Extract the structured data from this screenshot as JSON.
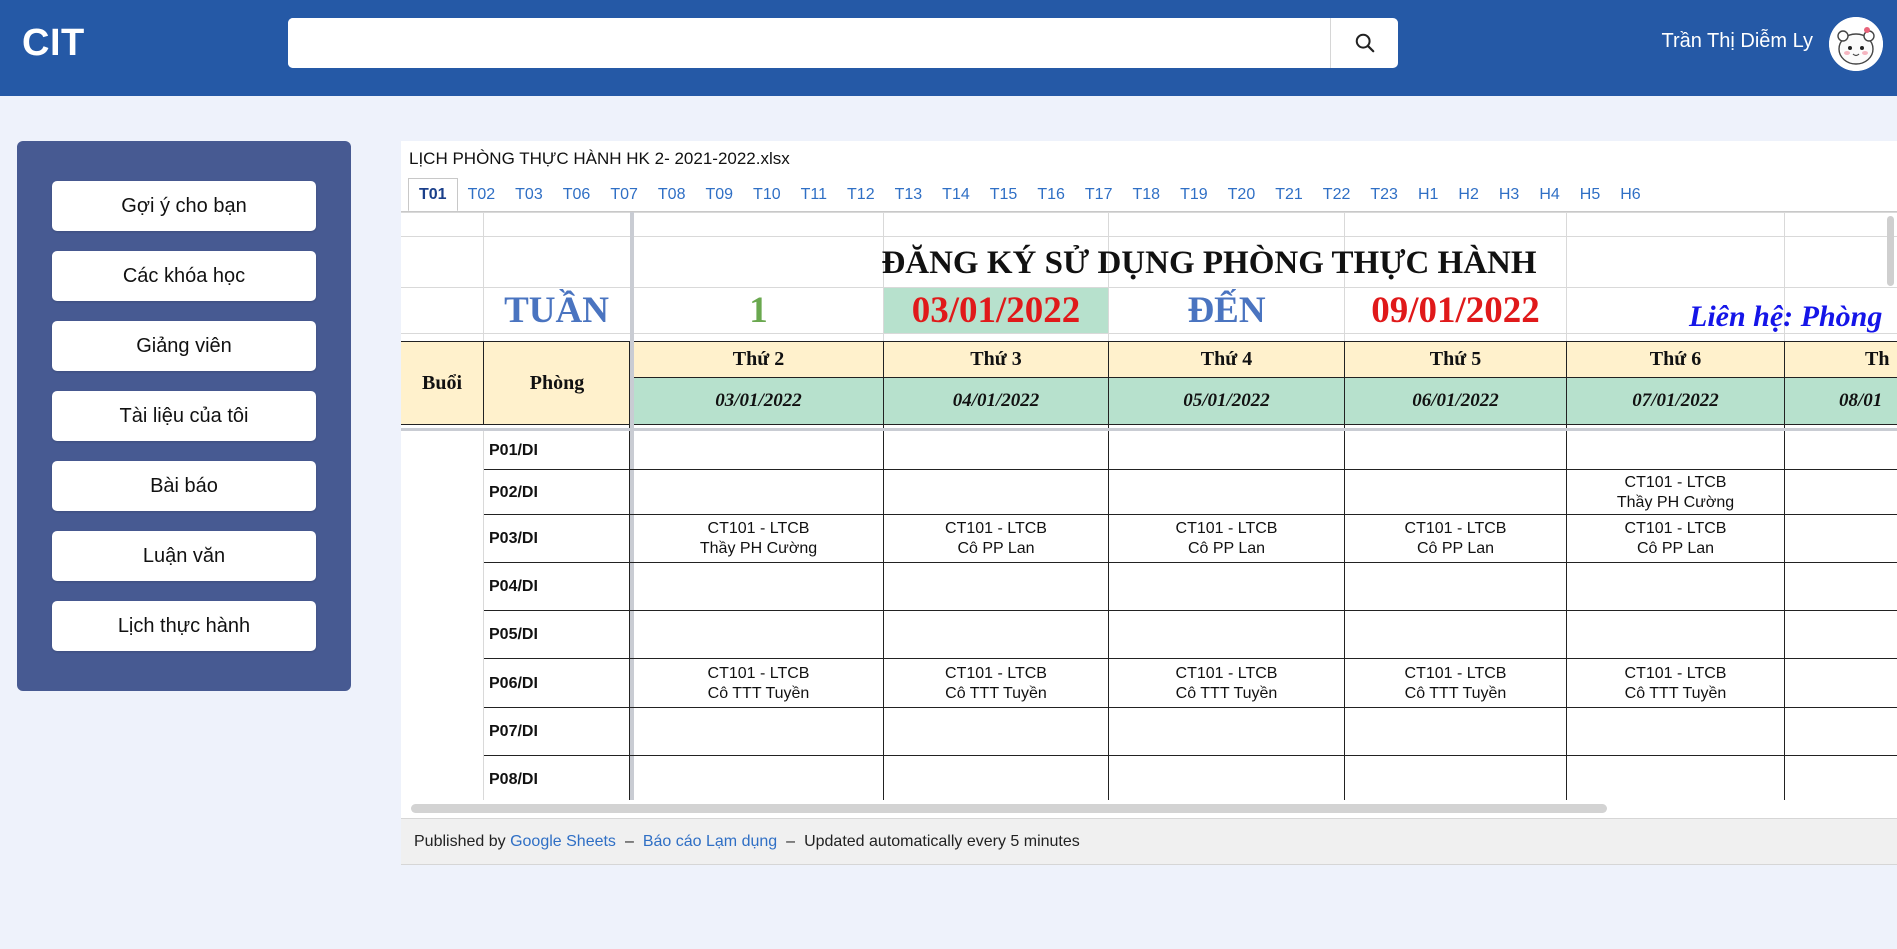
{
  "header": {
    "brand": "CIT",
    "search_placeholder": "",
    "user_name": "Trần Thị Diễm Ly"
  },
  "sidebar": {
    "items": [
      {
        "label": "Gợi ý cho bạn"
      },
      {
        "label": "Các khóa học"
      },
      {
        "label": "Giảng viên"
      },
      {
        "label": "Tài liệu của tôi"
      },
      {
        "label": "Bài báo"
      },
      {
        "label": "Luận văn"
      },
      {
        "label": "Lịch thực hành"
      }
    ]
  },
  "sheet": {
    "file_title": "LỊCH PHÒNG THỰC HÀNH HK 2- 2021-2022.xlsx",
    "tabs": [
      "T01",
      "T02",
      "T03",
      "T06",
      "T07",
      "T08",
      "T09",
      "T10",
      "T11",
      "T12",
      "T13",
      "T14",
      "T15",
      "T16",
      "T17",
      "T18",
      "T19",
      "T20",
      "T21",
      "T22",
      "T23",
      "H1",
      "H2",
      "H3",
      "H4",
      "H5",
      "H6"
    ],
    "active_tab": "T01",
    "heading": "ĐĂNG KÝ SỬ DỤNG PHÒNG THỰC HÀNH",
    "week_label": "TUẦN",
    "week_number": "1",
    "date_from": "03/01/2022",
    "to_label": "ĐẾN",
    "date_to": "09/01/2022",
    "contact": "Liên hệ: Phòng",
    "col_session": "Buổi",
    "col_room": "Phòng",
    "days": [
      {
        "name": "Thứ 2",
        "date": "03/01/2022"
      },
      {
        "name": "Thứ 3",
        "date": "04/01/2022"
      },
      {
        "name": "Thứ 4",
        "date": "05/01/2022"
      },
      {
        "name": "Thứ 5",
        "date": "06/01/2022"
      },
      {
        "name": "Thứ 6",
        "date": "07/01/2022"
      },
      {
        "name": "Th",
        "date": "08/01"
      }
    ],
    "rooms": [
      {
        "name": "P01/DI",
        "entries": [
          "",
          "",
          "",
          "",
          "",
          ""
        ]
      },
      {
        "name": "P02/DI",
        "entries": [
          "",
          "",
          "",
          "",
          "CT101 - LTCB|Thầy PH Cường",
          ""
        ]
      },
      {
        "name": "P03/DI",
        "entries": [
          "CT101 - LTCB|Thầy PH Cường",
          "CT101 - LTCB|Cô PP Lan",
          "CT101 - LTCB|Cô PP Lan",
          "CT101 - LTCB|Cô PP Lan",
          "CT101 - LTCB|Cô PP Lan",
          ""
        ]
      },
      {
        "name": "P04/DI",
        "entries": [
          "",
          "",
          "",
          "",
          "",
          ""
        ]
      },
      {
        "name": "P05/DI",
        "entries": [
          "",
          "",
          "",
          "",
          "",
          ""
        ]
      },
      {
        "name": "P06/DI",
        "entries": [
          "CT101 - LTCB|Cô TTT Tuyền",
          "CT101 - LTCB|Cô TTT Tuyền",
          "CT101 - LTCB|Cô TTT Tuyền",
          "CT101 - LTCB|Cô TTT Tuyền",
          "CT101 - LTCB|Cô TTT Tuyền",
          ""
        ]
      },
      {
        "name": "P07/DI",
        "entries": [
          "",
          "",
          "",
          "",
          "",
          ""
        ]
      },
      {
        "name": "P08/DI",
        "entries": [
          "",
          "",
          "",
          "",
          "",
          ""
        ]
      }
    ]
  },
  "footer": {
    "published_by": "Published by",
    "google_sheets": "Google Sheets",
    "dash1": "–",
    "report_abuse": "Báo cáo Lạm dụng",
    "dash2": "–",
    "updated": "Updated automatically every 5 minutes"
  }
}
